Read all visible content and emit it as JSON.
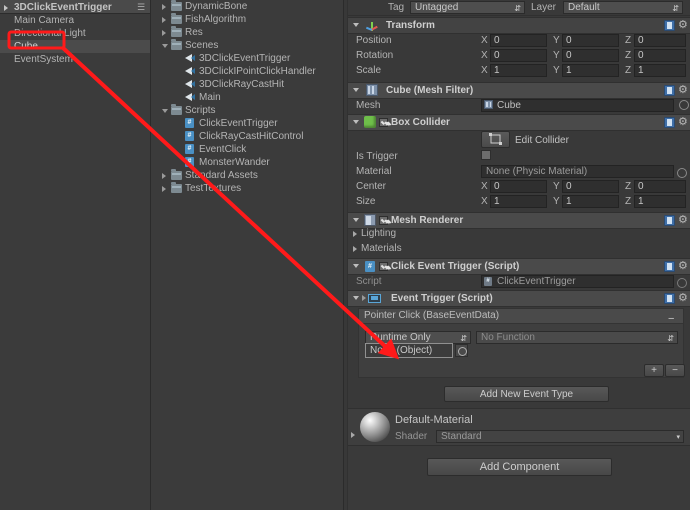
{
  "hierarchy": {
    "title": "3DClickEventTrigger",
    "items": [
      {
        "label": "Main Camera",
        "selected": false
      },
      {
        "label": "Directional Light",
        "selected": false
      },
      {
        "label": "Cube",
        "selected": true
      },
      {
        "label": "EventSystem",
        "selected": false
      }
    ]
  },
  "project": {
    "items": [
      {
        "label": "DynamicBone",
        "icon": "folder",
        "indent": 1,
        "fold": "right"
      },
      {
        "label": "FishAlgorithm",
        "icon": "folder",
        "indent": 1,
        "fold": "right"
      },
      {
        "label": "Res",
        "icon": "folder",
        "indent": 1,
        "fold": "right"
      },
      {
        "label": "Scenes",
        "icon": "folder",
        "indent": 1,
        "fold": "down"
      },
      {
        "label": "3DClickEventTrigger",
        "icon": "scene",
        "indent": 2,
        "fold": "none"
      },
      {
        "label": "3DClickIPointClickHandler",
        "icon": "scene",
        "indent": 2,
        "fold": "none"
      },
      {
        "label": "3DClickRayCastHit",
        "icon": "scene",
        "indent": 2,
        "fold": "none"
      },
      {
        "label": "Main",
        "icon": "scene",
        "indent": 2,
        "fold": "none"
      },
      {
        "label": "Scripts",
        "icon": "folder",
        "indent": 1,
        "fold": "down"
      },
      {
        "label": "ClickEventTrigger",
        "icon": "cs",
        "indent": 2,
        "fold": "none"
      },
      {
        "label": "ClickRayCastHitControl",
        "icon": "cs",
        "indent": 2,
        "fold": "none"
      },
      {
        "label": "EventClick",
        "icon": "cs",
        "indent": 2,
        "fold": "none"
      },
      {
        "label": "MonsterWander",
        "icon": "cs",
        "indent": 2,
        "fold": "none"
      },
      {
        "label": "Standard Assets",
        "icon": "folder",
        "indent": 1,
        "fold": "right"
      },
      {
        "label": "TestTextures",
        "icon": "folder",
        "indent": 1,
        "fold": "right"
      }
    ]
  },
  "inspector": {
    "tag_label": "Tag",
    "tag_value": "Untagged",
    "layer_label": "Layer",
    "layer_value": "Default",
    "transform": {
      "title": "Transform",
      "rows": [
        {
          "label": "Position",
          "x": "0",
          "y": "0",
          "z": "0"
        },
        {
          "label": "Rotation",
          "x": "0",
          "y": "0",
          "z": "0"
        },
        {
          "label": "Scale",
          "x": "1",
          "y": "1",
          "z": "1"
        }
      ],
      "axis_x": "X",
      "axis_y": "Y",
      "axis_z": "Z"
    },
    "mesh_filter": {
      "title": "Cube (Mesh Filter)",
      "mesh_label": "Mesh",
      "mesh_value": "Cube"
    },
    "box_collider": {
      "title": "Box Collider",
      "edit_collider_label": "Edit Collider",
      "is_trigger_label": "Is Trigger",
      "is_trigger_checked": false,
      "material_label": "Material",
      "material_value": "None (Physic Material)",
      "center_label": "Center",
      "center": {
        "x": "0",
        "y": "0",
        "z": "0"
      },
      "size_label": "Size",
      "size": {
        "x": "1",
        "y": "1",
        "z": "1"
      }
    },
    "mesh_renderer": {
      "title": "Mesh Renderer",
      "lighting_label": "Lighting",
      "materials_label": "Materials"
    },
    "click_event_trigger": {
      "title": "Click Event Trigger (Script)",
      "script_label": "Script",
      "script_value": "ClickEventTrigger"
    },
    "event_trigger": {
      "title": "Event Trigger (Script)",
      "event_name": "Pointer Click (BaseEventData)",
      "callback_mode": "Runtime Only",
      "function_value": "No Function",
      "object_value": "None (Object)",
      "add_btn": "+",
      "remove_btn": "−",
      "collapse_btn": "−",
      "add_event_type_label": "Add New Event Type"
    },
    "material_preview": {
      "name": "Default-Material",
      "shader_label": "Shader",
      "shader_value": "Standard"
    },
    "add_component_label": "Add Component"
  },
  "annotation": {
    "color": "#ff1a1a",
    "highlight_target": "Cube",
    "arrow_target": "None (Object)"
  }
}
